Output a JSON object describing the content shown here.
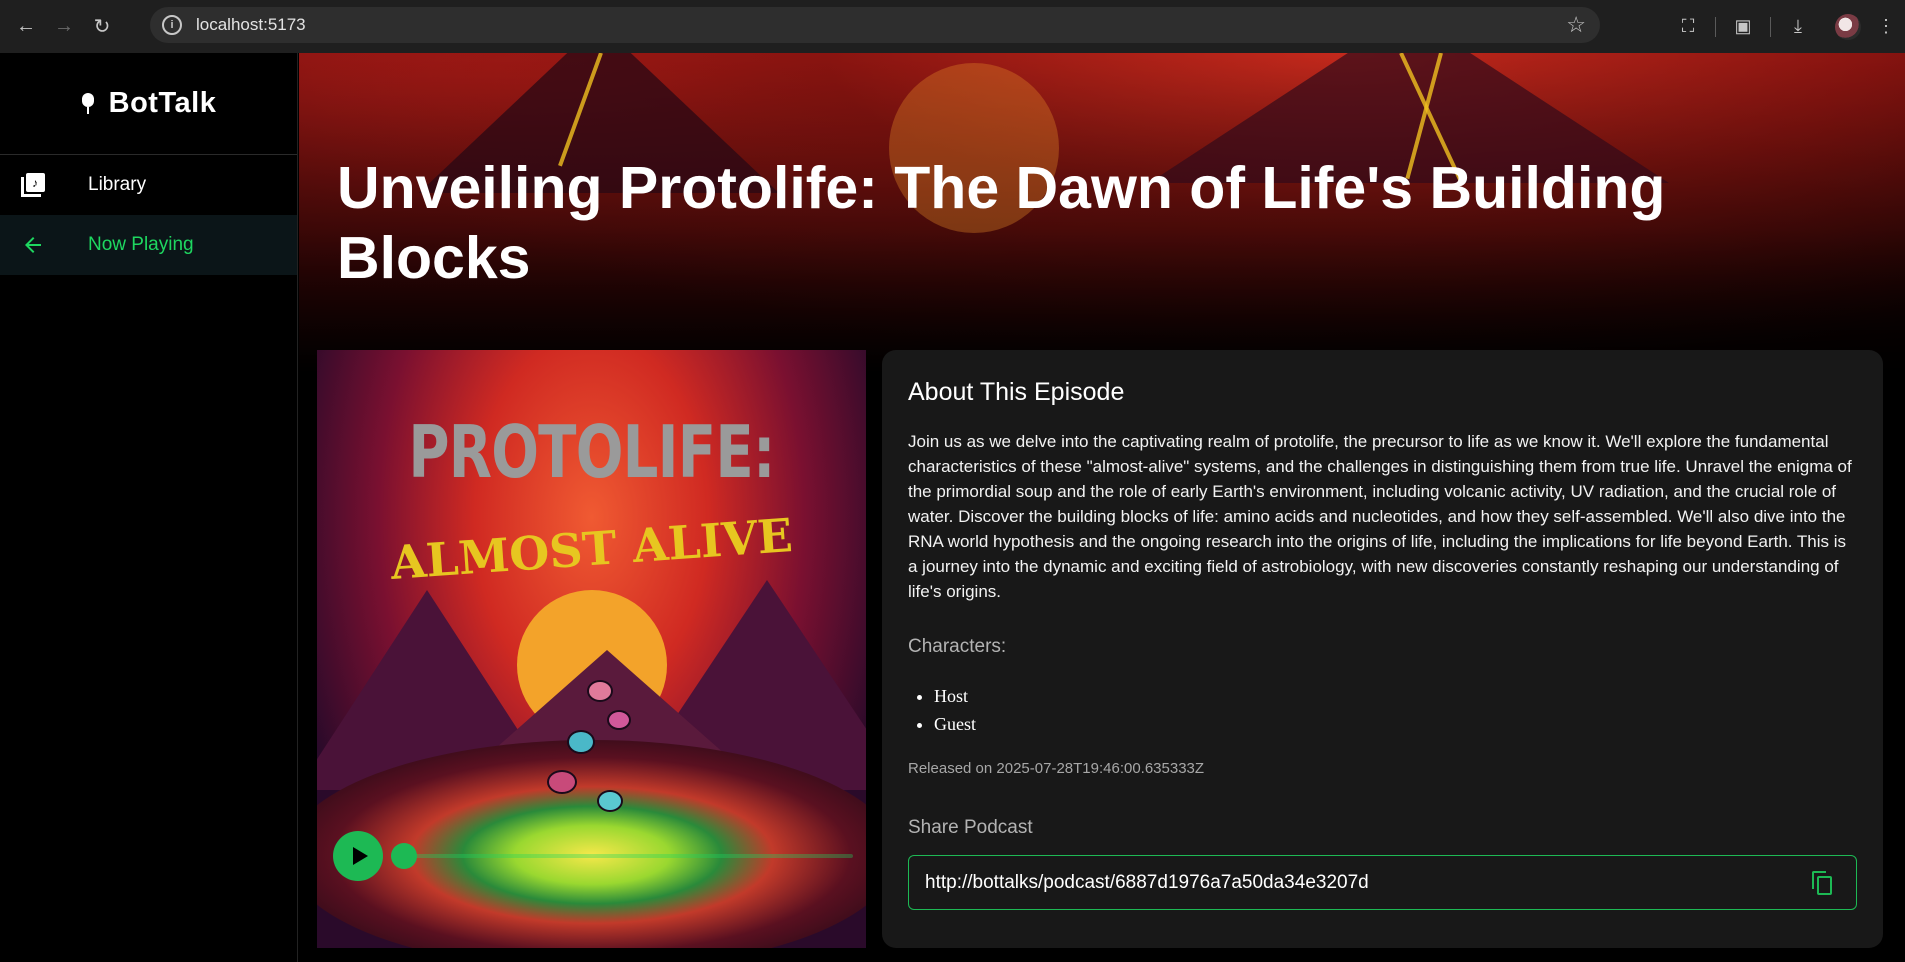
{
  "browser": {
    "url": "localhost:5173"
  },
  "sidebar": {
    "brand": "BotTalk",
    "items": [
      {
        "label": "Library",
        "icon": "library-music-icon",
        "active": false
      },
      {
        "label": "Now Playing",
        "icon": "arrow-back-icon",
        "active": true
      }
    ]
  },
  "episode": {
    "title": "Unveiling Protolife: The Dawn of Life's Building Blocks",
    "cover": {
      "title": "PROTOLIFE:",
      "subtitle": "ALMOST ALIVE"
    },
    "player": {
      "progress": 0
    },
    "about": {
      "heading": "About This Episode",
      "description": "Join us as we delve into the captivating realm of protolife, the precursor to life as we know it. We'll explore the fundamental characteristics of these \"almost-alive\" systems, and the challenges in distinguishing them from true life. Unravel the enigma of the primordial soup and the role of early Earth's environment, including volcanic activity, UV radiation, and the crucial role of water. Discover the building blocks of life: amino acids and nucleotides, and how they self-assembled. We'll also dive into the RNA world hypothesis and the ongoing research into the origins of life, including the implications for life beyond Earth. This is a journey into the dynamic and exciting field of astrobiology, with new discoveries constantly reshaping our understanding of life's origins.",
      "characters_label": "Characters:",
      "characters": [
        "Host",
        "Guest"
      ],
      "released": "Released on 2025-07-28T19:46:00.635333Z",
      "share_label": "Share Podcast",
      "share_link": "http://bottalks/podcast/6887d1976a7a50da34e3207d"
    }
  },
  "colors": {
    "accent": "#1db954",
    "background": "#000000",
    "card": "#181818"
  }
}
